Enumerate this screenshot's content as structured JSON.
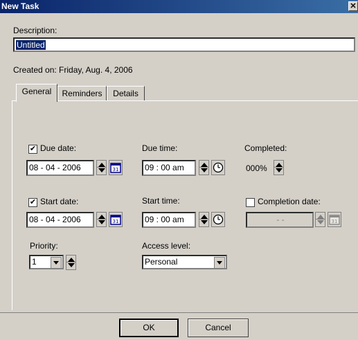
{
  "window": {
    "title": "New Task"
  },
  "description": {
    "label": "Description:",
    "value": "Untitled"
  },
  "created_on": "Created on: Friday, Aug. 4, 2006",
  "tabs": [
    {
      "label": "General",
      "active": true
    },
    {
      "label": "Reminders",
      "active": false
    },
    {
      "label": "Details",
      "active": false
    }
  ],
  "general": {
    "due_date": {
      "label": "Due date:",
      "checked": true,
      "value": "08 - 04 - 2006"
    },
    "due_time": {
      "label": "Due time:",
      "value": "09 : 00  am"
    },
    "completed": {
      "label": "Completed:",
      "value": "000%"
    },
    "start_date": {
      "label": "Start date:",
      "checked": true,
      "value": "08 - 04 - 2006"
    },
    "start_time": {
      "label": "Start time:",
      "value": "09 : 00  am"
    },
    "completion_date": {
      "label": "Completion date:",
      "checked": false,
      "value": "-      -"
    },
    "priority": {
      "label": "Priority:",
      "value": "1"
    },
    "access_level": {
      "label": "Access level:",
      "value": "Personal"
    }
  },
  "buttons": {
    "ok": "OK",
    "cancel": "Cancel"
  },
  "icons": {
    "calendar": "calendar-icon",
    "clock": "clock-icon",
    "check": "✔"
  }
}
